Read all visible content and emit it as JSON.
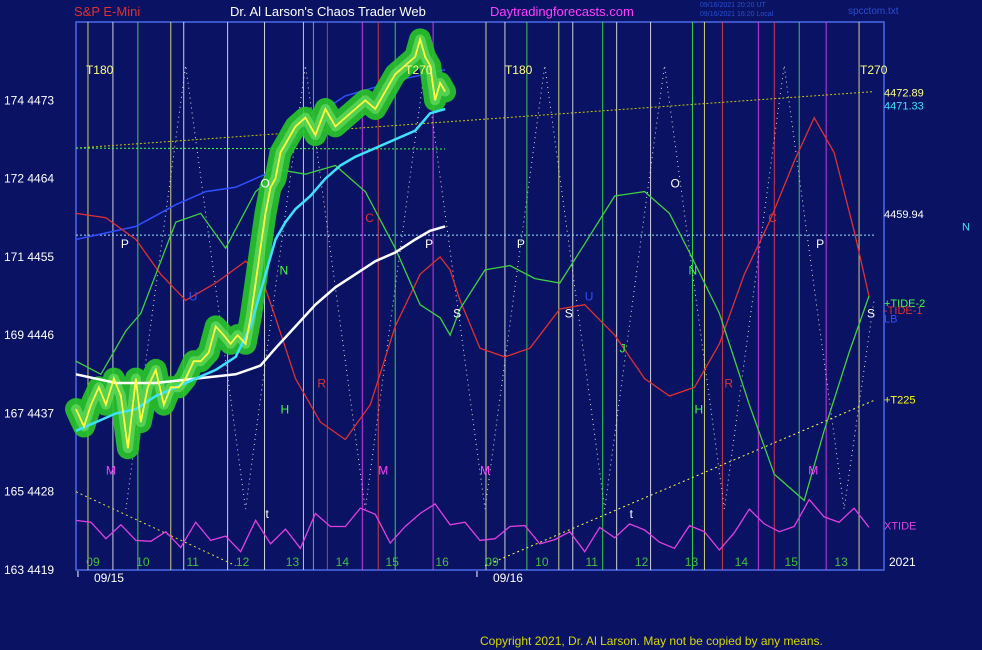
{
  "header": {
    "symbol": "S&P E-Mini",
    "title": "Dr. Al Larson's Chaos Trader Web",
    "site": "Daytradingforecasts.com",
    "stamp1": "09/16/2021 20:20 UT",
    "stamp2": "09/16/2021 16:20 Local",
    "file": "spcctom.txt",
    "copyright": "Copyright 2021, Dr. Al Larson. May not be copied by any means."
  },
  "colors": {
    "background": "#0a1264",
    "plot_border": "#4a6ae8",
    "header_red": "#e03030",
    "header_white": "#ffffff",
    "header_magenta": "#ff40ff",
    "price": "#ffff40",
    "avg_fast": "#40e0ff",
    "avg_slow": "#ffffff",
    "glow": "#28c828",
    "tide1": "#e03030",
    "tide2": "#40d040",
    "xtide": "#e040e0",
    "level_blue": "#3050ff"
  },
  "chart_data": {
    "type": "line",
    "x_range": [
      9.0,
      17.1
    ],
    "ylim": [
      4419,
      4482
    ],
    "y_ticks": [
      {
        "value": 4473,
        "label": "174  4473"
      },
      {
        "value": 4464,
        "label": "172  4464"
      },
      {
        "value": 4455,
        "label": "171  4455"
      },
      {
        "value": 4446,
        "label": "169  4446"
      },
      {
        "value": 4437,
        "label": "167  4437"
      },
      {
        "value": 4428,
        "label": "165  4428"
      },
      {
        "value": 4419,
        "label": "163  4419"
      }
    ],
    "x_ticks": [
      {
        "x": 9.17,
        "label": "09",
        "color": "#40c040"
      },
      {
        "x": 9.67,
        "label": "10",
        "color": "#40c040"
      },
      {
        "x": 10.17,
        "label": "11",
        "color": "#40c040"
      },
      {
        "x": 10.67,
        "label": "12",
        "color": "#40c040"
      },
      {
        "x": 11.17,
        "label": "13",
        "color": "#40c040"
      },
      {
        "x": 11.67,
        "label": "14",
        "color": "#40c040"
      },
      {
        "x": 12.17,
        "label": "15",
        "color": "#40c040"
      },
      {
        "x": 12.67,
        "label": "16",
        "color": "#40c040"
      },
      {
        "x": 13.17,
        "label": "09",
        "color": "#40c040"
      },
      {
        "x": 13.67,
        "label": "10",
        "color": "#40c040"
      },
      {
        "x": 14.17,
        "label": "11",
        "color": "#40c040"
      },
      {
        "x": 14.67,
        "label": "12",
        "color": "#40c040"
      },
      {
        "x": 15.17,
        "label": "13",
        "color": "#40c040"
      },
      {
        "x": 15.67,
        "label": "14",
        "color": "#40c040"
      },
      {
        "x": 16.17,
        "label": "15",
        "color": "#40c040"
      },
      {
        "x": 16.67,
        "label": "13",
        "color": "#40c040"
      }
    ],
    "date_labels": [
      {
        "x": 9.2,
        "label": "09/15"
      },
      {
        "x": 13.2,
        "label": "09/16"
      }
    ],
    "year_label": "2021",
    "vertical_markers": [
      {
        "x": 9.12,
        "color": "#ffff80"
      },
      {
        "x": 9.37,
        "color": "#ffffff"
      },
      {
        "x": 9.62,
        "color": "#40ff40"
      },
      {
        "x": 9.95,
        "color": "#ffff80"
      },
      {
        "x": 10.08,
        "color": "#ffffff"
      },
      {
        "x": 10.52,
        "color": "#ffffff"
      },
      {
        "x": 10.89,
        "color": "#ffffff"
      },
      {
        "x": 11.28,
        "color": "#ffff80"
      },
      {
        "x": 11.38,
        "color": "#40ff40"
      },
      {
        "x": 11.52,
        "color": "#ff4040"
      },
      {
        "x": 11.87,
        "color": "#ff40ff"
      },
      {
        "x": 12.03,
        "color": "#ff4040"
      },
      {
        "x": 12.2,
        "color": "#40ff40"
      },
      {
        "x": 12.58,
        "color": "#ff40ff"
      },
      {
        "x": 13.11,
        "color": "#ffff80"
      },
      {
        "x": 13.3,
        "color": "#ffffff"
      },
      {
        "x": 13.52,
        "color": "#40ff40"
      },
      {
        "x": 13.84,
        "color": "#ffff80"
      },
      {
        "x": 13.98,
        "color": "#ffffff"
      },
      {
        "x": 14.28,
        "color": "#40ff40"
      },
      {
        "x": 14.42,
        "color": "#ffffff"
      },
      {
        "x": 14.76,
        "color": "#ffffff"
      },
      {
        "x": 15.18,
        "color": "#40ff40"
      },
      {
        "x": 15.3,
        "color": "#ffff80"
      },
      {
        "x": 15.48,
        "color": "#ff4040"
      },
      {
        "x": 15.84,
        "color": "#ff40ff"
      },
      {
        "x": 16.0,
        "color": "#ff4040"
      },
      {
        "x": 16.25,
        "color": "#40ff40"
      },
      {
        "x": 16.52,
        "color": "#ff40ff"
      },
      {
        "x": 16.85,
        "color": "#ffff80"
      }
    ],
    "cycle_labels": [
      {
        "x": 9.1,
        "y": 4476,
        "label": "T180",
        "color": "#ffff80"
      },
      {
        "x": 12.3,
        "y": 4476,
        "label": "T270",
        "color": "#ffff80"
      },
      {
        "x": 13.3,
        "y": 4476,
        "label": "T180",
        "color": "#ffff80"
      },
      {
        "x": 16.86,
        "y": 4476,
        "label": "T270",
        "color": "#ffff80"
      }
    ],
    "planet_letters": [
      {
        "x": 9.45,
        "y": 4456,
        "label": "P",
        "color": "#ffffff"
      },
      {
        "x": 10.85,
        "y": 4463,
        "label": "O",
        "color": "#ffffff"
      },
      {
        "x": 12.5,
        "y": 4456,
        "label": "P",
        "color": "#ffffff"
      },
      {
        "x": 13.42,
        "y": 4456,
        "label": "P",
        "color": "#ffffff"
      },
      {
        "x": 14.96,
        "y": 4463,
        "label": "O",
        "color": "#ffffff"
      },
      {
        "x": 16.42,
        "y": 4456,
        "label": "P",
        "color": "#ffffff"
      },
      {
        "x": 12.78,
        "y": 4448,
        "label": "S",
        "color": "#ffffff"
      },
      {
        "x": 13.9,
        "y": 4448,
        "label": "S",
        "color": "#ffffff"
      },
      {
        "x": 16.93,
        "y": 4448,
        "label": "S",
        "color": "#ffffff"
      },
      {
        "x": 11.9,
        "y": 4459,
        "label": "C",
        "color": "#e03030"
      },
      {
        "x": 15.94,
        "y": 4459,
        "label": "C",
        "color": "#e03030"
      },
      {
        "x": 11.42,
        "y": 4440,
        "label": "R",
        "color": "#e03030"
      },
      {
        "x": 15.5,
        "y": 4440,
        "label": "R",
        "color": "#e03030"
      },
      {
        "x": 11.04,
        "y": 4453,
        "label": "N",
        "color": "#40ff40"
      },
      {
        "x": 15.14,
        "y": 4453,
        "label": "N",
        "color": "#40ff40"
      },
      {
        "x": 11.05,
        "y": 4437,
        "label": "H",
        "color": "#40ff40"
      },
      {
        "x": 15.2,
        "y": 4437,
        "label": "H",
        "color": "#40ff40"
      },
      {
        "x": 14.45,
        "y": 4444,
        "label": "J",
        "color": "#40ff40"
      },
      {
        "x": 9.3,
        "y": 4430,
        "label": "M",
        "color": "#ff40ff"
      },
      {
        "x": 12.03,
        "y": 4430,
        "label": "M",
        "color": "#ff40ff"
      },
      {
        "x": 13.05,
        "y": 4430,
        "label": "M",
        "color": "#ff40ff"
      },
      {
        "x": 16.34,
        "y": 4430,
        "label": "M",
        "color": "#ff40ff"
      },
      {
        "x": 10.13,
        "y": 4450,
        "label": "U",
        "color": "#3050ff"
      },
      {
        "x": 14.1,
        "y": 4450,
        "label": "U",
        "color": "#3050ff"
      },
      {
        "x": 10.9,
        "y": 4425,
        "label": "t",
        "color": "#ffffff"
      },
      {
        "x": 14.55,
        "y": 4425,
        "label": "t",
        "color": "#ffffff"
      }
    ],
    "levels": [
      {
        "y": 4467.5,
        "label": "",
        "color": "#c8c800"
      },
      {
        "y": 4457.5,
        "label": "4459.94",
        "color": "#ffffff"
      }
    ],
    "right_labels": [
      {
        "y": 4473.9,
        "label": "4472.89",
        "color": "#ffff80"
      },
      {
        "y": 4472.4,
        "label": "4471.33",
        "color": "#40e0ff"
      },
      {
        "y": 4459.9,
        "label": "4459.94",
        "color": "#ffffff"
      },
      {
        "y": 4449.7,
        "label": "+TIDE-2",
        "color": "#40ff40"
      },
      {
        "y": 4448.9,
        "label": "-TIDE-1",
        "color": "#e03030"
      },
      {
        "y": 4447.9,
        "label": "LB",
        "color": "#3050ff"
      },
      {
        "y": 4438.6,
        "label": "+T225",
        "color": "#ffff00"
      },
      {
        "y": 4424.1,
        "label": "XTIDE",
        "color": "#e040e0"
      }
    ],
    "far_right_label": {
      "label": "N",
      "y": 4458.5,
      "color": "#40e0ff"
    },
    "series": [
      {
        "key": "price",
        "x": [
          9.0,
          9.08,
          9.15,
          9.23,
          9.3,
          9.38,
          9.45,
          9.52,
          9.6,
          9.65,
          9.72,
          9.8,
          9.88,
          9.95,
          10.03,
          10.1,
          10.18,
          10.25,
          10.33,
          10.4,
          10.48,
          10.55,
          10.62,
          10.7,
          10.75,
          10.8,
          10.85,
          10.9,
          10.95,
          11.0,
          11.05,
          11.1,
          11.2,
          11.3,
          11.4,
          11.5,
          11.6,
          11.7,
          11.8,
          11.9,
          12.0,
          12.1,
          12.2,
          12.3,
          12.4,
          12.45,
          12.5,
          12.55,
          12.6,
          12.65,
          12.7
        ],
        "y": [
          4437.5,
          4435.5,
          4438,
          4440,
          4438,
          4441,
          4439,
          4433,
          4441,
          4436,
          4440,
          4442,
          4438,
          4440,
          4440,
          4441,
          4443,
          4443,
          4444,
          4447,
          4446,
          4445,
          4446,
          4445,
          4448,
          4452,
          4456,
          4460,
          4463,
          4464,
          4467,
          4468,
          4470,
          4471,
          4469,
          4472,
          4470,
          4471,
          4472,
          4473,
          4472,
          4474,
          4476,
          4477,
          4478,
          4480,
          4478,
          4477,
          4473,
          4475,
          4474
        ]
      },
      {
        "key": "avg_fast",
        "x": [
          9.0,
          9.2,
          9.4,
          9.6,
          9.8,
          10.0,
          10.2,
          10.4,
          10.6,
          10.75,
          10.9,
          11.0,
          11.1,
          11.2,
          11.35,
          11.5,
          11.65,
          11.8,
          12.0,
          12.2,
          12.4,
          12.55,
          12.7
        ],
        "y": [
          4435,
          4436,
          4437,
          4437.5,
          4439,
          4440,
          4441,
          4442,
          4443.5,
          4447,
          4453,
          4457,
          4459,
          4460.5,
          4462,
          4464,
          4465.5,
          4466.5,
          4467.5,
          4468.5,
          4469.5,
          4471.5,
          4472
        ]
      },
      {
        "key": "avg_slow",
        "x": [
          9.0,
          9.4,
          9.8,
          10.2,
          10.6,
          10.85,
          11.0,
          11.2,
          11.4,
          11.6,
          11.8,
          12.0,
          12.2,
          12.4,
          12.55,
          12.7
        ],
        "y": [
          4441.5,
          4440.5,
          4440.5,
          4441,
          4441.5,
          4442.5,
          4444.5,
          4447,
          4449.5,
          4451.5,
          4453,
          4454.5,
          4455.5,
          4457,
          4458,
          4458.5
        ]
      },
      {
        "key": "tide1",
        "x": [
          9.0,
          9.3,
          9.6,
          9.85,
          10.1,
          10.4,
          10.7,
          10.85,
          11.0,
          11.2,
          11.45,
          11.7,
          11.95,
          12.2,
          12.45,
          12.65,
          12.75,
          12.85,
          13.05,
          13.3,
          13.55,
          13.85,
          14.1,
          14.4,
          14.7,
          14.95,
          15.2,
          15.45,
          15.7,
          15.95,
          16.2,
          16.4,
          16.6,
          16.8,
          16.95
        ],
        "y": [
          4460,
          4459.5,
          4457,
          4453,
          4450,
          4452,
          4454.5,
          4453,
          4448,
          4441,
          4436,
          4434,
          4438,
          4447,
          4453,
          4455,
          4453.5,
          4450,
          4444.5,
          4443.5,
          4444.5,
          4449,
          4449.5,
          4446,
          4441,
          4439,
          4440,
          4445,
          4453,
          4459,
          4466,
          4471,
          4467,
          4458,
          4450.5
        ]
      },
      {
        "key": "tide2",
        "x": [
          9.0,
          9.25,
          9.5,
          9.65,
          9.8,
          10.0,
          10.25,
          10.5,
          10.8,
          11.05,
          11.3,
          11.6,
          11.9,
          12.2,
          12.45,
          12.65,
          12.75,
          12.85,
          13.1,
          13.35,
          13.6,
          13.85,
          14.1,
          14.4,
          14.7,
          14.95,
          15.15,
          15.45,
          15.75,
          16.0,
          16.3,
          16.5,
          16.75,
          16.95
        ],
        "y": [
          4443,
          4441.5,
          4446.5,
          4448.5,
          4453,
          4459,
          4460,
          4456,
          4462.5,
          4465,
          4464.5,
          4465.5,
          4462.5,
          4456,
          4449.5,
          4448,
          4446,
          4449,
          4453.5,
          4454,
          4452.5,
          4452,
          4456.5,
          4462,
          4462.5,
          4460,
          4455.5,
          4448.5,
          4438,
          4430,
          4427,
          4435,
          4444,
          4450.5
        ]
      },
      {
        "key": "level_blue",
        "x": [
          9.0,
          9.6,
          10.0,
          10.3,
          10.6,
          10.9,
          11.1,
          11.3,
          11.5,
          11.7,
          12.0,
          12.3,
          12.5,
          12.7
        ],
        "y": [
          4457,
          4458.5,
          4461,
          4462.5,
          4463,
          4464.5,
          4467,
          4470,
          4472,
          4473.5,
          4474.5,
          4475.5,
          4476,
          4476.5
        ]
      },
      {
        "key": "t225",
        "x": [
          13.1,
          17.0
        ],
        "y": [
          4419.5,
          4438.5
        ]
      },
      {
        "key": "xtide",
        "x": [
          9.0,
          9.15,
          9.3,
          9.45,
          9.6,
          9.75,
          9.9,
          10.05,
          10.2,
          10.35,
          10.5,
          10.65,
          10.8,
          10.95,
          11.1,
          11.25,
          11.4,
          11.55,
          11.7,
          11.85,
          12.0,
          12.15,
          12.3,
          12.45,
          12.6,
          12.75,
          12.9,
          13.05,
          13.2,
          13.35,
          13.5,
          13.65,
          13.8,
          13.95,
          14.1,
          14.25,
          14.4,
          14.55,
          14.7,
          14.85,
          15.0,
          15.15,
          15.3,
          15.45,
          15.6,
          15.75,
          15.9,
          16.05,
          16.2,
          16.35,
          16.5,
          16.65,
          16.8,
          16.95
        ],
        "y": [
          4424.7,
          4424.5,
          4422.6,
          4424.2,
          4422.4,
          4422.3,
          4423.4,
          4421.6,
          4424.5,
          4422.4,
          4422.9,
          4421.1,
          4424.7,
          4422.0,
          4423.7,
          4421.5,
          4425.5,
          4424.0,
          4424.0,
          4426.1,
          4425.4,
          4422.1,
          4424.0,
          4425.5,
          4426.6,
          4424.2,
          4424.5,
          4422.4,
          4422.6,
          4424.0,
          4424.1,
          4422.0,
          4422.5,
          4423.4,
          4421.1,
          4423.9,
          4422.7,
          4424.3,
          4423.6,
          4422.2,
          4421.5,
          4424.1,
          4423.4,
          4421.3,
          4423.3,
          4426.0,
          4424.3,
          4423.4,
          4424.0,
          4427.1,
          4425.1,
          4424.5,
          4426.1,
          4423.9
        ]
      },
      {
        "key": "dotted_wave",
        "x": [
          9.5,
          10.1,
          10.7,
          11.3,
          11.9,
          12.5,
          13.1,
          13.7,
          14.3,
          14.9,
          15.5,
          16.1,
          16.7,
          17.0
        ],
        "y": [
          4426,
          4477,
          4426,
          4477,
          4426,
          4477,
          4426,
          4477,
          4426,
          4477,
          4426,
          4477,
          4426,
          4450
        ]
      }
    ]
  }
}
